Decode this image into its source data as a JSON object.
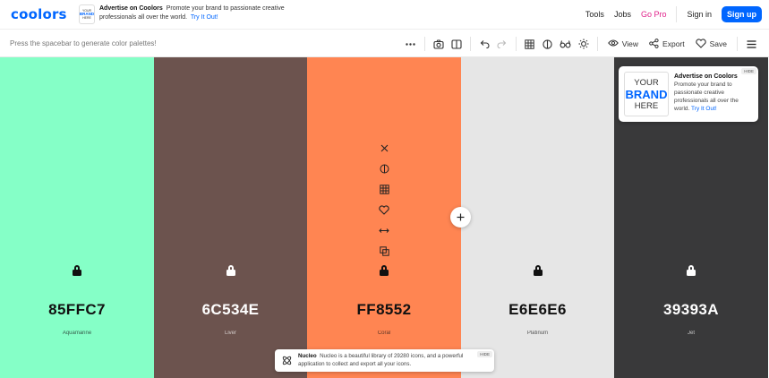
{
  "header": {
    "logo": "coolors",
    "ad": {
      "logo_top": "YOUR",
      "logo_mid": "BRAND",
      "logo_bottom": "HERE",
      "title": "Advertise on Coolors",
      "body": "Promote your brand to passionate creative professionals all over the world.",
      "link": "Try It Out!"
    },
    "nav": {
      "tools": "Tools",
      "jobs": "Jobs",
      "gopro": "Go Pro",
      "signin": "Sign in",
      "signup": "Sign up"
    }
  },
  "toolbar": {
    "hint": "Press the spacebar to generate color palettes!",
    "view_label": "View",
    "export_label": "Export",
    "save_label": "Save"
  },
  "palette": [
    {
      "hex": "85FFC7",
      "name": "Aquamarine",
      "color": "#85FFC7",
      "text_color": "#111111"
    },
    {
      "hex": "6C534E",
      "name": "Liver",
      "color": "#6C534E",
      "text_color": "#ffffff"
    },
    {
      "hex": "FF8552",
      "name": "Coral",
      "color": "#FF8552",
      "text_color": "#111111"
    },
    {
      "hex": "E6E6E6",
      "name": "Platinum",
      "color": "#E6E6E6",
      "text_color": "#111111"
    },
    {
      "hex": "39393A",
      "name": "Jet",
      "color": "#39393A",
      "text_color": "#ffffff"
    }
  ],
  "ad_card": {
    "brand_top": "YOUR",
    "brand_mid": "BRAND",
    "brand_bottom": "HERE",
    "title": "Advertise on Coolors",
    "body": "Promote your brand to passionate creative professionals all over the world.",
    "link": "Try It Out!",
    "hide": "HIDE"
  },
  "nucleo": {
    "title": "Nucleo",
    "body": "Nucleo is a beautiful library of 29280 icons, and a powerful application to collect and export all your icons.",
    "hide": "HIDE"
  }
}
